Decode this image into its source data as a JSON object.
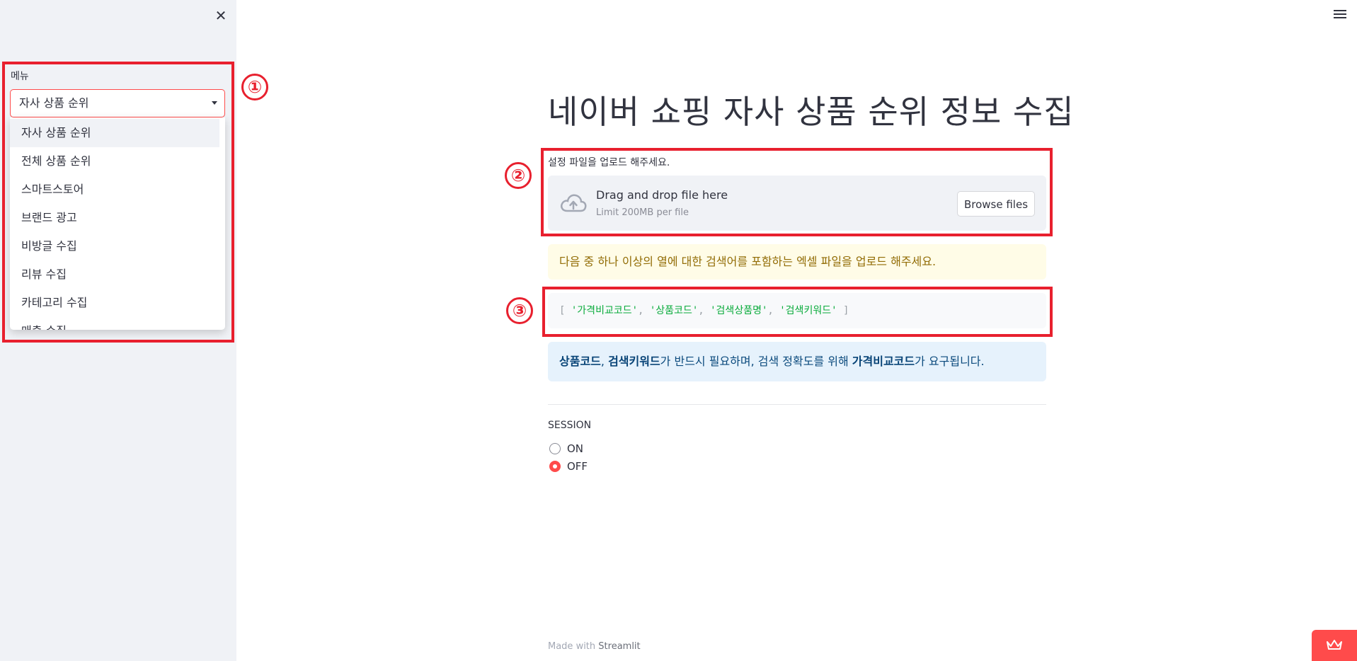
{
  "sidebar": {
    "close_icon": "close-icon",
    "menu_label": "메뉴",
    "selected_value": "자사 상품 순위",
    "options": [
      "자사 상품 순위",
      "전체 상품 순위",
      "스마트스토어",
      "브랜드 광고",
      "비방글 수집",
      "리뷰 수집",
      "카테고리 수집",
      "매출 수집"
    ]
  },
  "annotations": {
    "num1": "①",
    "num2": "②",
    "num3": "③",
    "color": "#e8202e"
  },
  "main": {
    "title": "네이버 쇼핑 자사 상품 순위 정보 수집",
    "upload": {
      "label": "설정 파일을 업로드 해주세요.",
      "drag_text": "Drag and drop file here",
      "limit_text": "Limit 200MB per file",
      "browse_label": "Browse files",
      "icon": "cloud-upload-icon"
    },
    "warning": "다음 중 하나 이상의 열에 대한 검색어를 포함하는 엑셀 파일을 업로드 해주세요.",
    "code": {
      "open": "[",
      "close": "]",
      "items": [
        "'가격비교코드'",
        "'상품코드'",
        "'검색상품명'",
        "'검색키워드'"
      ]
    },
    "info": {
      "bold1": "상품코드",
      "sep": ", ",
      "bold2": "검색키워드",
      "mid": "가 반드시 필요하며, 검색 정확도를 위해 ",
      "bold3": "가격비교코드",
      "end": "가 요구됩니다."
    },
    "session": {
      "label": "SESSION",
      "options": [
        "ON",
        "OFF"
      ],
      "selected": "OFF"
    }
  },
  "footer": {
    "prefix": "Made with ",
    "link": "Streamlit"
  },
  "colors": {
    "accent": "#ff4b4b",
    "sidebar_bg": "#f0f2f6",
    "warning_bg": "#fffce7",
    "info_bg": "#e6f2fc"
  }
}
